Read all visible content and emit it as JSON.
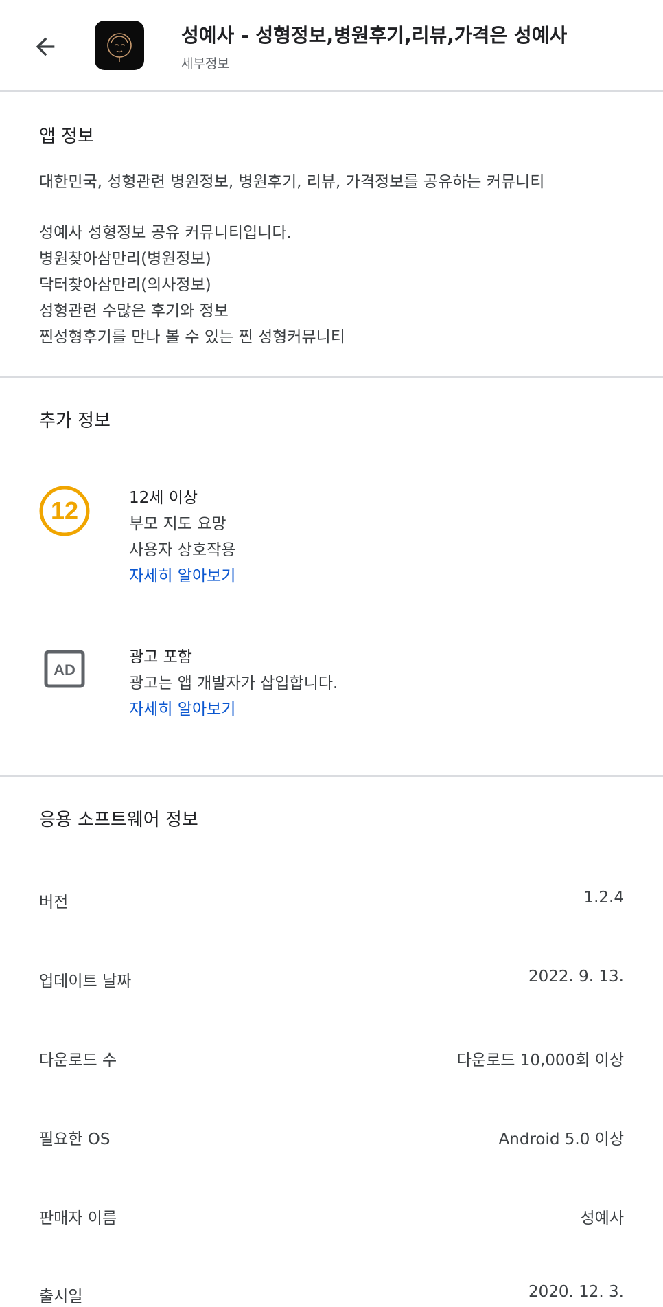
{
  "header": {
    "title": "성예사 - 성형정보,병원후기,리뷰,가격은 성예사",
    "subtitle": "세부정보"
  },
  "app_info": {
    "heading": "앱 정보",
    "summary": "대한민국, 성형관련 병원정보, 병원후기, 리뷰, 가격정보를 공유하는 커뮤니티",
    "lines": [
      "성예사 성형정보 공유 커뮤니티입니다.",
      "병원찾아삼만리(병원정보)",
      "닥터찾아삼만리(의사정보)",
      "성형관련 수많은 후기와 정보",
      "찐성형후기를 만나 볼 수 있는 찐 성형커뮤니티"
    ]
  },
  "additional_info": {
    "heading": "추가 정보",
    "rating": {
      "badge": "12",
      "badge_color": "#f0a500",
      "title": "12세 이상",
      "lines": [
        "부모 지도 요망",
        "사용자 상호작용"
      ],
      "link": "자세히 알아보기"
    },
    "ads": {
      "icon_label": "AD",
      "title": "광고 포함",
      "desc": "광고는 앱 개발자가 삽입합니다.",
      "link": "자세히 알아보기"
    }
  },
  "software_info": {
    "heading": "응용 소프트웨어 정보",
    "rows": [
      {
        "label": "버전",
        "value": "1.2.4"
      },
      {
        "label": "업데이트 날짜",
        "value": "2022. 9. 13."
      },
      {
        "label": "다운로드 수",
        "value": "다운로드 10,000회 이상"
      },
      {
        "label": "필요한 OS",
        "value": "Android 5.0 이상"
      },
      {
        "label": "판매자 이름",
        "value": "성예사"
      },
      {
        "label": "출시일",
        "value": "2020. 12. 3."
      }
    ]
  },
  "colors": {
    "link": "#0b57d0",
    "divider": "#dadce0",
    "rating_badge": "#f0a500"
  }
}
